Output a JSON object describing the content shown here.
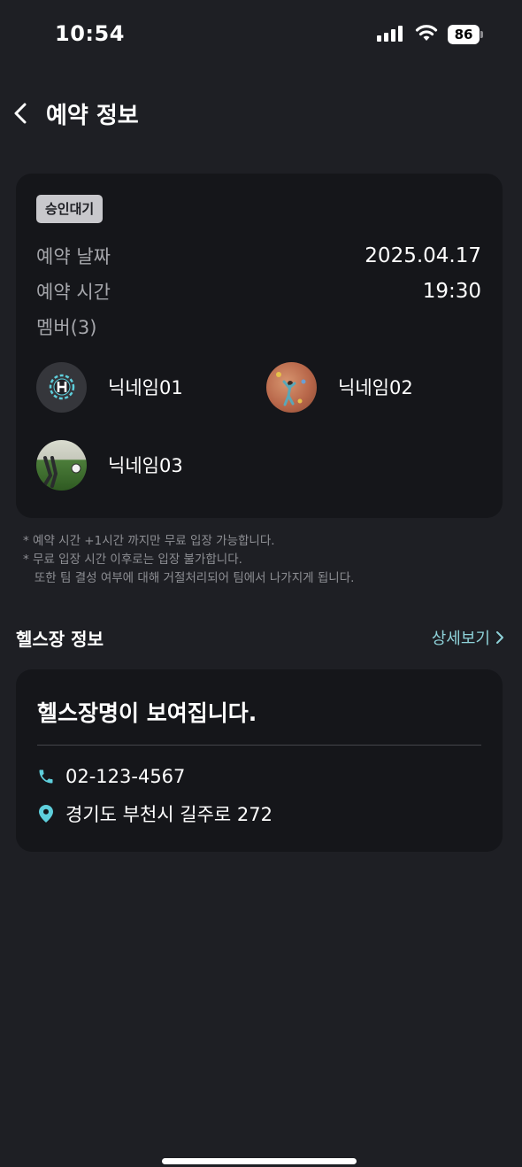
{
  "status_bar": {
    "time": "10:54",
    "battery": "86"
  },
  "header": {
    "title": "예약 정보",
    "back_icon": "chevron-left-icon"
  },
  "reservation": {
    "status_badge": "승인대기",
    "date_label": "예약 날짜",
    "date_value": "2025.04.17",
    "time_label": "예약 시간",
    "time_value": "19:30",
    "members_label": "멤버(3)",
    "members": [
      {
        "name": "닉네임01",
        "avatar": "logo-avatar"
      },
      {
        "name": "닉네임02",
        "avatar": "climbing-photo-avatar"
      },
      {
        "name": "닉네임03",
        "avatar": "soccer-photo-avatar"
      }
    ]
  },
  "notes": [
    "* 예약 시간 +1시간 까지만 무료 입장 가능합니다.",
    "* 무료 입장 시간 이후로는 입장 불가합니다.",
    "   또한 팀 결성 여부에 대해 거절처리되어 팀에서 나가지게 됩니다."
  ],
  "gym": {
    "section_title": "헬스장 정보",
    "detail_link": "상세보기",
    "name": "헬스장명이 보여집니다.",
    "phone": "02-123-4567",
    "address": "경기도 부천시 길주로 272"
  },
  "colors": {
    "background": "#1e1f24",
    "card": "#15161a",
    "accent": "#8fd3da",
    "icon_teal": "#5ecfdc",
    "badge_bg": "#c8c8cc"
  }
}
